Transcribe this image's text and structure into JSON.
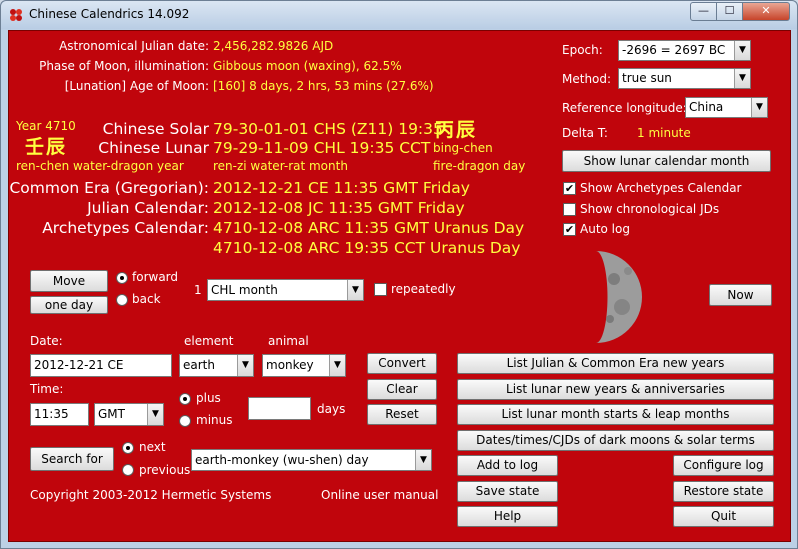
{
  "window": {
    "title": "Chinese Calendrics 14.092",
    "minimize": "—",
    "maximize": "☐",
    "close": "✕"
  },
  "astro": {
    "jd_label": "Astronomical Julian date:",
    "jd_value": "2,456,282.9826 AJD",
    "phase_label": "Phase of Moon, illumination:",
    "phase_value": "Gibbous moon (waxing), 62.5%",
    "age_label": "[Lunation] Age of Moon:",
    "age_value": "[160] 8 days, 2 hrs, 53 mins (27.6%)"
  },
  "year": {
    "label": "Year 4710",
    "chars": "壬辰",
    "name": "ren-chen water-dragon year"
  },
  "chinese": {
    "solar_label": "Chinese Solar",
    "solar_value": "79-30-01-01 CHS (Z11) 19:35",
    "lunar_label": "Chinese Lunar",
    "lunar_value": "79-29-11-09 CHL 19:35 CCT",
    "month_name": "ren-zi water-rat month"
  },
  "day": {
    "chars": "丙辰",
    "pinyin": "bing-chen",
    "name": "fire-dragon day"
  },
  "calendars": {
    "ce_label": "Common Era (Gregorian):",
    "ce_value": "2012-12-21 CE 11:35 GMT Friday",
    "jc_label": "Julian Calendar:",
    "jc_value": "2012-12-08 JC 11:35 GMT Friday",
    "arc_label": "Archetypes Calendar:",
    "arc_value1": "4710-12-08 ARC 11:35 GMT Uranus Day",
    "arc_value2": "4710-12-08 ARC 19:35 CCT Uranus Day"
  },
  "settings": {
    "epoch_label": "Epoch:",
    "epoch_value": "-2696 = 2697 BC",
    "method_label": "Method:",
    "method_value": "true sun",
    "reflong_label": "Reference longitude:",
    "reflong_value": "China",
    "deltat_label": "Delta T:",
    "deltat_value": "1 minute",
    "show_lunar_button": "Show lunar calendar month"
  },
  "options": {
    "archetypes": {
      "label": "Show Archetypes Calendar",
      "checked": "✔"
    },
    "chrono": {
      "label": "Show chronological JDs",
      "checked": ""
    },
    "autolog": {
      "label": "Auto log",
      "checked": "✔"
    }
  },
  "move": {
    "move_button": "Move",
    "one_day_button": "one day",
    "forward_label": "forward",
    "back_label": "back",
    "count": "1",
    "unit_value": "CHL month",
    "repeatedly_label": "repeatedly"
  },
  "now_button": "Now",
  "date": {
    "date_label": "Date:",
    "date_value": "2012-12-21 CE",
    "element_label": "element",
    "element_value": "earth",
    "animal_label": "animal",
    "animal_value": "monkey",
    "time_label": "Time:",
    "time_value": "11:35",
    "tz_value": "GMT",
    "plus_label": "plus",
    "minus_label": "minus",
    "days_value": "",
    "days_label": "days",
    "convert_button": "Convert",
    "clear_button": "Clear",
    "reset_button": "Reset"
  },
  "search": {
    "search_button": "Search for",
    "next_label": "next",
    "previous_label": "previous",
    "search_value": "earth-monkey (wu-shen) day"
  },
  "lists": {
    "julian_ce": "List Julian & Common Era new years",
    "lunar_new_years": "List lunar new years & anniversaries",
    "lunar_months": "List lunar month starts & leap months",
    "dark_moons": "Dates/times/CJDs of dark moons & solar terms"
  },
  "actions": {
    "add_log": "Add to log",
    "configure_log": "Configure log",
    "save_state": "Save state",
    "restore_state": "Restore state",
    "help": "Help",
    "quit": "Quit"
  },
  "footer": {
    "copyright": "Copyright 2003-2012 Hermetic Systems",
    "manual": "Online user manual"
  },
  "moon": {
    "illumination": 0.625,
    "phase": "waxing gibbous"
  }
}
